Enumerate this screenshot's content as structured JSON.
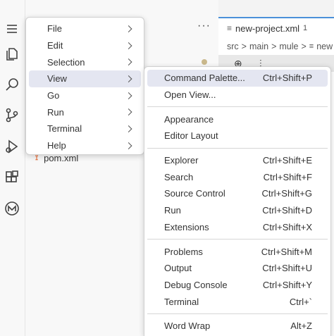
{
  "activity_bar": {
    "icons": [
      "explorer-icon",
      "search-icon",
      "source-control-icon",
      "run-debug-icon",
      "extensions-icon",
      "mule-icon"
    ]
  },
  "sidebar": {
    "more": "···",
    "file_item": "pom.xml"
  },
  "editor": {
    "tab_title": "new-project.xml",
    "tab_badge": "1",
    "breadcrumb": [
      "src",
      ">",
      "main",
      ">",
      "mule",
      ">",
      "new"
    ]
  },
  "main_menu": [
    {
      "label": "File"
    },
    {
      "label": "Edit"
    },
    {
      "label": "Selection"
    },
    {
      "label": "View"
    },
    {
      "label": "Go"
    },
    {
      "label": "Run"
    },
    {
      "label": "Terminal"
    },
    {
      "label": "Help"
    }
  ],
  "view_menu": {
    "groups": [
      [
        {
          "label": "Command Palette...",
          "shortcut": "Ctrl+Shift+P"
        },
        {
          "label": "Open View...",
          "shortcut": ""
        }
      ],
      [
        {
          "label": "Appearance",
          "shortcut": ""
        },
        {
          "label": "Editor Layout",
          "shortcut": ""
        }
      ],
      [
        {
          "label": "Explorer",
          "shortcut": "Ctrl+Shift+E"
        },
        {
          "label": "Search",
          "shortcut": "Ctrl+Shift+F"
        },
        {
          "label": "Source Control",
          "shortcut": "Ctrl+Shift+G"
        },
        {
          "label": "Run",
          "shortcut": "Ctrl+Shift+D"
        },
        {
          "label": "Extensions",
          "shortcut": "Ctrl+Shift+X"
        }
      ],
      [
        {
          "label": "Problems",
          "shortcut": "Ctrl+Shift+M"
        },
        {
          "label": "Output",
          "shortcut": "Ctrl+Shift+U"
        },
        {
          "label": "Debug Console",
          "shortcut": "Ctrl+Shift+Y"
        },
        {
          "label": "Terminal",
          "shortcut": "Ctrl+`"
        }
      ],
      [
        {
          "label": "Word Wrap",
          "shortcut": "Alt+Z"
        }
      ]
    ]
  }
}
